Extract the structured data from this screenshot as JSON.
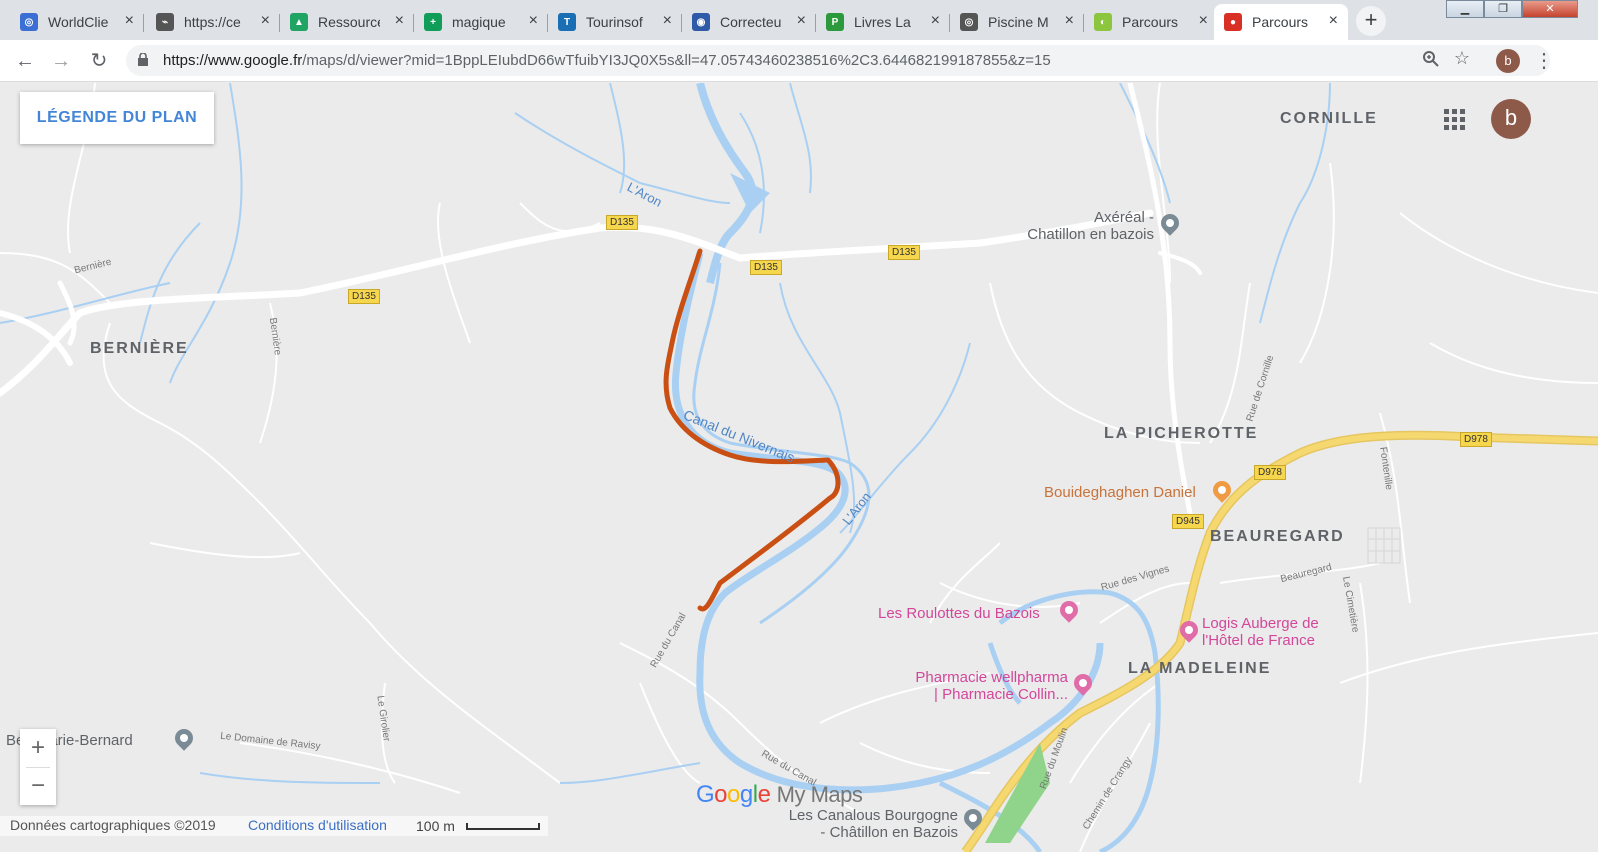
{
  "browser": {
    "tabs": [
      {
        "title": "WorldClie",
        "icon": "globe-icon",
        "color": "#3b6fd4"
      },
      {
        "title": "https://ce",
        "icon": "link-icon",
        "color": "#555555"
      },
      {
        "title": "Ressource",
        "icon": "drive-icon",
        "color": "#1fa463"
      },
      {
        "title": "magique",
        "icon": "plus-doc-icon",
        "color": "#0f9d58"
      },
      {
        "title": "Tourinsof",
        "icon": "tis-icon",
        "color": "#1a6fb4"
      },
      {
        "title": "Correcteu",
        "icon": "target-icon",
        "color": "#2e5aa8"
      },
      {
        "title": "Livres La",
        "icon": "px-icon",
        "color": "#2c9a3c"
      },
      {
        "title": "Piscine M",
        "icon": "globe-icon",
        "color": "#555555"
      },
      {
        "title": "Parcours",
        "icon": "leaf-icon",
        "color": "#8cc63f"
      },
      {
        "title": "Parcours",
        "icon": "maps-pin-icon",
        "color": "#d93025"
      }
    ],
    "new_tab": "+",
    "url_host": "https://www.google.fr",
    "url_path": "/maps/d/viewer?mid=1BppLEIubdD66wTfuibYI3JQ0X5s&ll=47.05743460238516%2C3.644682199187855&z=15",
    "profile_initial": "b"
  },
  "map": {
    "legend_button": "LÉGENDE DU PLAN",
    "avatar_initial": "b",
    "places": {
      "corneille": "CORNILLE",
      "berniere": "BERNIÈRE",
      "picherotte": "LA PICHEROTTE",
      "beauregard": "BEAUREGARD",
      "madeleine": "LA MADELEINE"
    },
    "pois": {
      "axereal_1": "Axéréal -",
      "axereal_2": "Chatillon en bazois",
      "bouideghaghen": "Bouideghaghen Daniel",
      "roulottes": "Les Roulottes du Bazois",
      "logis_1": "Logis Auberge de",
      "logis_2": "l'Hôtel de France",
      "pharmacie_1": "Pharmacie wellpharma",
      "pharmacie_2": "| Pharmacie Collin...",
      "canalous_1": "Les Canalous Bourgogne",
      "canalous_2": "- Châtillon en Bazois",
      "marie_bernard": "Be     t Marie-Bernard"
    },
    "roads": {
      "d135_a": "D135",
      "d135_b": "D135",
      "d135_c": "D135",
      "d135_d": "D135",
      "d978_a": "D978",
      "d978_b": "D978",
      "d945": "D945",
      "berniere_a": "Bernière",
      "berniere_b": "Bernière",
      "rue_canal_a": "Rue du Canal",
      "rue_canal_b": "Rue du Canal",
      "rue_cornille": "Rue de Cornille",
      "fontenille": "Fontenille",
      "rue_vignes": "Rue des Vignes",
      "beauregard_rd": "Beauregard",
      "cimetiere": "Le Cimetière",
      "rue_moulin": "Rue du Moulin",
      "chemin_crangy": "Chemin de Crangy",
      "domaine_ravisy": "Le Domaine de Ravisy",
      "le_girolier": "Le Girolier"
    },
    "water": {
      "aron_a": "L'Aron",
      "aron_b": "L'Aron",
      "canal": "Canal du Nivernais"
    },
    "zoom_in": "+",
    "zoom_out": "−",
    "logo_google": "Google",
    "logo_mymaps": "My Maps",
    "footer_data": "Données cartographiques ©2019",
    "footer_terms": "Conditions d'utilisation",
    "footer_scale": "100 m"
  },
  "colors": {
    "route": "#c94f12",
    "water": "#a9d0f2",
    "highway": "#f6d871",
    "pin_grey": "#7b8b96",
    "pin_pink": "#e06ca8",
    "pin_orange": "#f09a43",
    "avatar": "#8d5a4a"
  }
}
